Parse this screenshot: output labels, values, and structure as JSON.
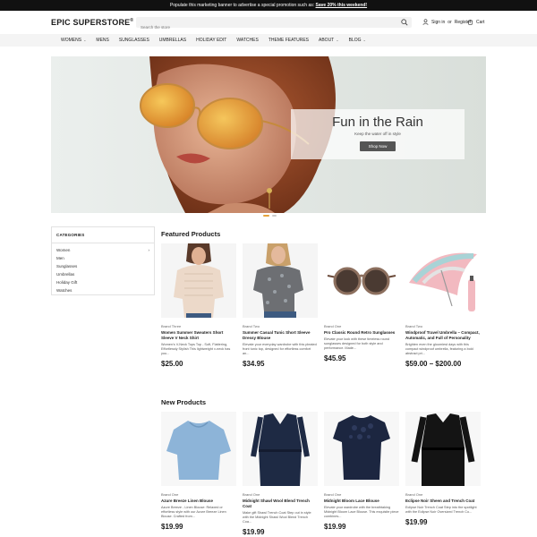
{
  "promo": {
    "text": "Populate this marketing banner to advertise a special promotion such as:",
    "link": "Save 20% this weekend!"
  },
  "header": {
    "logo": "EPIC SUPERSTORE",
    "logo_mark": "®",
    "search_placeholder": "Search the store",
    "signin": "Sign in",
    "or": "or",
    "register": "Register",
    "cart": "Cart"
  },
  "nav": {
    "items": [
      {
        "label": "WOMENS",
        "dropdown": true
      },
      {
        "label": "MENS",
        "dropdown": false
      },
      {
        "label": "SUNGLASSES",
        "dropdown": false
      },
      {
        "label": "UMBRELLAS",
        "dropdown": false
      },
      {
        "label": "HOLIDAY EDIT",
        "dropdown": false
      },
      {
        "label": "WATCHES",
        "dropdown": false
      },
      {
        "label": "THEME FEATURES",
        "dropdown": false
      },
      {
        "label": "ABOUT",
        "dropdown": true
      },
      {
        "label": "BLOG",
        "dropdown": true
      }
    ]
  },
  "hero": {
    "title": "Fun in the Rain",
    "subtitle": "Keep the water off in style",
    "button": "Shop Now"
  },
  "categories": {
    "heading": "CATEGORIES",
    "items": [
      {
        "label": "Women",
        "expand": "›"
      },
      {
        "label": "Men",
        "expand": ""
      },
      {
        "label": "Sunglasses",
        "expand": ""
      },
      {
        "label": "Umbrellas",
        "expand": ""
      },
      {
        "label": "Holiday Gift",
        "expand": ""
      },
      {
        "label": "Watches",
        "expand": ""
      }
    ]
  },
  "featured": {
    "title": "Featured Products",
    "products": [
      {
        "brand": "Brand Three",
        "name": "Women Summer Sweaters Short Sleeve V Neck Shirt",
        "desc": "Women's V-Neck Tops Top - Soft, Flattering, Effortlessly Stylish This lightweight v-neck has you...",
        "price": "$25.00"
      },
      {
        "brand": "Brand Two",
        "name": "Summer Casual Tunic Short Sleeve Dressy Blouse",
        "desc": "Elevate your everyday wardrobe with this pleated front tunic top, designed for effortless comfort an...",
        "price": "$34.95"
      },
      {
        "brand": "Brand One",
        "name": "Pro Classic Round Retro Sunglasses",
        "desc": "Elevate your look with these timeless round sunglasses designed for both style and performance. Made...",
        "price": "$45.95"
      },
      {
        "brand": "Brand Two",
        "name": "Windproof Travel Umbrella – Compact, Automatic, and Full of Personality",
        "desc": "Brighten even the gloomiest days with this compact windproof umbrella, featuring a bold abstract pri...",
        "price": "$59.00 – $200.00"
      }
    ]
  },
  "new_products": {
    "title": "New Products",
    "products": [
      {
        "brand": "Brand One",
        "name": "Azure Breeze Linen Blouse",
        "desc": "Azure Breeze - Linen Blouse: Relaxed or effortless style with our Azure Breeze Linen Blouse. Crafted from...",
        "price": "$19.99"
      },
      {
        "brand": "Brand One",
        "name": "Midnight Shawl Wool Blend Trench Coat",
        "desc": "Make gift Shawl Trench Coat Step out in style with the Midnight Shawl Wool Blend Trench Coa...",
        "price": "$19.99"
      },
      {
        "brand": "Brand One",
        "name": "Midnight Bloom Lace Blouse",
        "desc": "Elevate your wardrobe with the breathtaking Midnight Bloom Lace Blouse. This exquisite piece combines...",
        "price": "$19.99"
      },
      {
        "brand": "Brand One",
        "name": "Eclipse Noir Sheen and Trench Coat",
        "desc": "Eclipse Noir Trench Coat Step into the spotlight with the Eclipse Noir Oversized Trench Co...",
        "price": "$19.99"
      }
    ]
  },
  "colors": {
    "accent": "#e6a23c",
    "promo_bg": "#111111",
    "nav_bg": "#f4f4f4"
  }
}
